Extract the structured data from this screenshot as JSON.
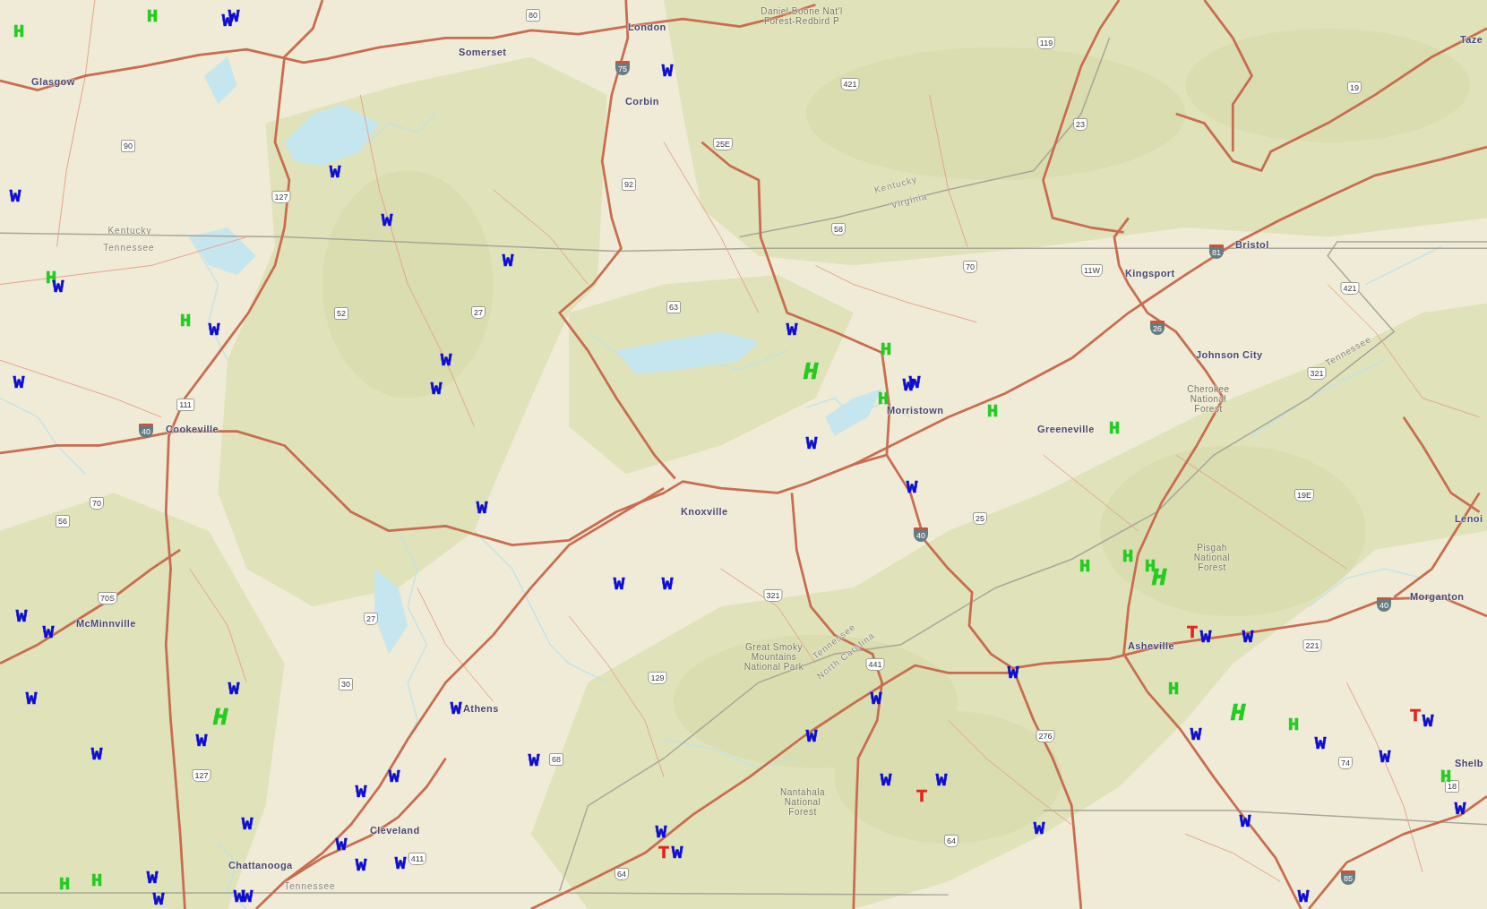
{
  "map": {
    "city_labels": [
      "London",
      "Taze",
      "Somerset",
      "Glasgow",
      "Corbin",
      "Bristol",
      "Kingsport",
      "Johnson City",
      "Morristown",
      "Cookeville",
      "Greeneville",
      "Knoxville",
      "Lenoi",
      "Morganton",
      "McMinnville",
      "Asheville",
      "Athens",
      "Shelb",
      "Cleveland",
      "Chattanooga"
    ],
    "state_labels": [
      "Kentucky",
      "Virginia",
      "Kentucky",
      "Tennessee",
      "Tennessee",
      "Tennessee",
      "North Carolina",
      "Tennessee"
    ],
    "area_labels": [
      {
        "lines": [
          "Daniel Boone Nat'l",
          "Forest-Redbird P"
        ]
      },
      {
        "lines": [
          "Cherokee",
          "National",
          "Forest"
        ]
      },
      {
        "lines": [
          "Pisgah",
          "National",
          "Forest"
        ]
      },
      {
        "lines": [
          "Great Smoky",
          "Mountains",
          "National Park"
        ]
      },
      {
        "lines": [
          "Nantahala",
          "National",
          "Forest"
        ]
      }
    ],
    "route_shields": [
      {
        "number": "80",
        "kind": "state"
      },
      {
        "number": "119",
        "kind": "us"
      },
      {
        "number": "75",
        "kind": "interstate"
      },
      {
        "number": "421",
        "kind": "us"
      },
      {
        "number": "19",
        "kind": "us"
      },
      {
        "number": "23",
        "kind": "us"
      },
      {
        "number": "90",
        "kind": "state"
      },
      {
        "number": "25E",
        "kind": "us"
      },
      {
        "number": "92",
        "kind": "state"
      },
      {
        "number": "127",
        "kind": "us"
      },
      {
        "number": "58",
        "kind": "us"
      },
      {
        "number": "81",
        "kind": "interstate"
      },
      {
        "number": "70",
        "kind": "us"
      },
      {
        "number": "11W",
        "kind": "us"
      },
      {
        "number": "421",
        "kind": "us"
      },
      {
        "number": "52",
        "kind": "state"
      },
      {
        "number": "27",
        "kind": "us"
      },
      {
        "number": "63",
        "kind": "state"
      },
      {
        "number": "26",
        "kind": "interstate"
      },
      {
        "number": "321",
        "kind": "us"
      },
      {
        "number": "111",
        "kind": "state"
      },
      {
        "number": "40",
        "kind": "interstate"
      },
      {
        "number": "70",
        "kind": "us"
      },
      {
        "number": "19E",
        "kind": "us"
      },
      {
        "number": "56",
        "kind": "state"
      },
      {
        "number": "25",
        "kind": "us"
      },
      {
        "number": "40",
        "kind": "interstate"
      },
      {
        "number": "70S",
        "kind": "us"
      },
      {
        "number": "321",
        "kind": "us"
      },
      {
        "number": "40",
        "kind": "interstate"
      },
      {
        "number": "27",
        "kind": "us"
      },
      {
        "number": "221",
        "kind": "us"
      },
      {
        "number": "441",
        "kind": "us"
      },
      {
        "number": "30",
        "kind": "state"
      },
      {
        "number": "129",
        "kind": "us"
      },
      {
        "number": "276",
        "kind": "us"
      },
      {
        "number": "68",
        "kind": "state"
      },
      {
        "number": "74",
        "kind": "us"
      },
      {
        "number": "127",
        "kind": "us"
      },
      {
        "number": "18",
        "kind": "state"
      },
      {
        "number": "64",
        "kind": "us"
      },
      {
        "number": "411",
        "kind": "us"
      },
      {
        "number": "64",
        "kind": "us"
      },
      {
        "number": "85",
        "kind": "interstate"
      }
    ],
    "markers": [
      {
        "letter": "H",
        "color": "#22cc22",
        "kind": "normal"
      },
      {
        "letter": "W",
        "color": "#0c0cd4",
        "kind": "normal"
      },
      {
        "letter": "W",
        "color": "#0c0cd4",
        "kind": "normal"
      },
      {
        "letter": "H",
        "color": "#22cc22",
        "kind": "normal"
      },
      {
        "letter": "W",
        "color": "#0c0cd4",
        "kind": "normal"
      },
      {
        "letter": "W",
        "color": "#0c0cd4",
        "kind": "normal"
      },
      {
        "letter": "W",
        "color": "#0c0cd4",
        "kind": "normal"
      },
      {
        "letter": "W",
        "color": "#0c0cd4",
        "kind": "normal"
      },
      {
        "letter": "W",
        "color": "#0c0cd4",
        "kind": "normal"
      },
      {
        "letter": "H",
        "color": "#22cc22",
        "kind": "normal"
      },
      {
        "letter": "W",
        "color": "#0c0cd4",
        "kind": "normal"
      },
      {
        "letter": "H",
        "color": "#22cc22",
        "kind": "normal"
      },
      {
        "letter": "W",
        "color": "#0c0cd4",
        "kind": "normal"
      },
      {
        "letter": "W",
        "color": "#0c0cd4",
        "kind": "normal"
      },
      {
        "letter": "H",
        "color": "#22cc22",
        "kind": "normal"
      },
      {
        "letter": "W",
        "color": "#0c0cd4",
        "kind": "normal"
      },
      {
        "letter": "H",
        "color": "#22cc22",
        "kind": "large"
      },
      {
        "letter": "W",
        "color": "#0c0cd4",
        "kind": "normal"
      },
      {
        "letter": "W",
        "color": "#0c0cd4",
        "kind": "normal"
      },
      {
        "letter": "W",
        "color": "#0c0cd4",
        "kind": "normal"
      },
      {
        "letter": "W",
        "color": "#0c0cd4",
        "kind": "normal"
      },
      {
        "letter": "H",
        "color": "#22cc22",
        "kind": "normal"
      },
      {
        "letter": "H",
        "color": "#22cc22",
        "kind": "normal"
      },
      {
        "letter": "H",
        "color": "#22cc22",
        "kind": "normal"
      },
      {
        "letter": "W",
        "color": "#0c0cd4",
        "kind": "normal"
      },
      {
        "letter": "W",
        "color": "#0c0cd4",
        "kind": "normal"
      },
      {
        "letter": "W",
        "color": "#0c0cd4",
        "kind": "normal"
      },
      {
        "letter": "H",
        "color": "#22cc22",
        "kind": "normal"
      },
      {
        "letter": "H",
        "color": "#22cc22",
        "kind": "normal"
      },
      {
        "letter": "H",
        "color": "#22cc22",
        "kind": "normal"
      },
      {
        "letter": "W",
        "color": "#0c0cd4",
        "kind": "normal"
      },
      {
        "letter": "W",
        "color": "#0c0cd4",
        "kind": "normal"
      },
      {
        "letter": "H",
        "color": "#22cc22",
        "kind": "large"
      },
      {
        "letter": "W",
        "color": "#0c0cd4",
        "kind": "normal"
      },
      {
        "letter": "W",
        "color": "#0c0cd4",
        "kind": "normal"
      },
      {
        "letter": "T",
        "color": "#e3261d",
        "kind": "normal"
      },
      {
        "letter": "W",
        "color": "#0c0cd4",
        "kind": "normal"
      },
      {
        "letter": "W",
        "color": "#0c0cd4",
        "kind": "normal"
      },
      {
        "letter": "W",
        "color": "#0c0cd4",
        "kind": "normal"
      },
      {
        "letter": "W",
        "color": "#0c0cd4",
        "kind": "normal"
      },
      {
        "letter": "H",
        "color": "#22cc22",
        "kind": "normal"
      },
      {
        "letter": "W",
        "color": "#0c0cd4",
        "kind": "normal"
      },
      {
        "letter": "W",
        "color": "#0c0cd4",
        "kind": "normal"
      },
      {
        "letter": "H",
        "color": "#22cc22",
        "kind": "large"
      },
      {
        "letter": "W",
        "color": "#0c0cd4",
        "kind": "normal"
      },
      {
        "letter": "H",
        "color": "#22cc22",
        "kind": "large"
      },
      {
        "letter": "H",
        "color": "#22cc22",
        "kind": "normal"
      },
      {
        "letter": "T",
        "color": "#e3261d",
        "kind": "normal"
      },
      {
        "letter": "W",
        "color": "#0c0cd4",
        "kind": "normal"
      },
      {
        "letter": "W",
        "color": "#0c0cd4",
        "kind": "normal"
      },
      {
        "letter": "W",
        "color": "#0c0cd4",
        "kind": "normal"
      },
      {
        "letter": "W",
        "color": "#0c0cd4",
        "kind": "normal"
      },
      {
        "letter": "W",
        "color": "#0c0cd4",
        "kind": "normal"
      },
      {
        "letter": "W",
        "color": "#0c0cd4",
        "kind": "normal"
      },
      {
        "letter": "W",
        "color": "#0c0cd4",
        "kind": "normal"
      },
      {
        "letter": "W",
        "color": "#0c0cd4",
        "kind": "normal"
      },
      {
        "letter": "W",
        "color": "#0c0cd4",
        "kind": "normal"
      },
      {
        "letter": "W",
        "color": "#0c0cd4",
        "kind": "normal"
      },
      {
        "letter": "W",
        "color": "#0c0cd4",
        "kind": "normal"
      },
      {
        "letter": "H",
        "color": "#22cc22",
        "kind": "normal"
      },
      {
        "letter": "W",
        "color": "#0c0cd4",
        "kind": "normal"
      },
      {
        "letter": "T",
        "color": "#e3261d",
        "kind": "normal"
      },
      {
        "letter": "W",
        "color": "#0c0cd4",
        "kind": "normal"
      },
      {
        "letter": "W",
        "color": "#0c0cd4",
        "kind": "normal"
      },
      {
        "letter": "W",
        "color": "#0c0cd4",
        "kind": "normal"
      },
      {
        "letter": "W",
        "color": "#0c0cd4",
        "kind": "normal"
      },
      {
        "letter": "W",
        "color": "#0c0cd4",
        "kind": "normal"
      },
      {
        "letter": "W",
        "color": "#0c0cd4",
        "kind": "normal"
      },
      {
        "letter": "T",
        "color": "#e3261d",
        "kind": "normal"
      },
      {
        "letter": "W",
        "color": "#0c0cd4",
        "kind": "normal"
      },
      {
        "letter": "W",
        "color": "#0c0cd4",
        "kind": "normal"
      },
      {
        "letter": "W",
        "color": "#0c0cd4",
        "kind": "normal"
      },
      {
        "letter": "H",
        "color": "#22cc22",
        "kind": "normal"
      },
      {
        "letter": "H",
        "color": "#22cc22",
        "kind": "normal"
      },
      {
        "letter": "W",
        "color": "#0c0cd4",
        "kind": "normal"
      },
      {
        "letter": "W",
        "color": "#0c0cd4",
        "kind": "normal"
      },
      {
        "letter": "W",
        "color": "#0c0cd4",
        "kind": "normal"
      },
      {
        "letter": "W",
        "color": "#0c0cd4",
        "kind": "normal"
      },
      {
        "letter": "W",
        "color": "#0c0cd4",
        "kind": "normal"
      }
    ]
  }
}
